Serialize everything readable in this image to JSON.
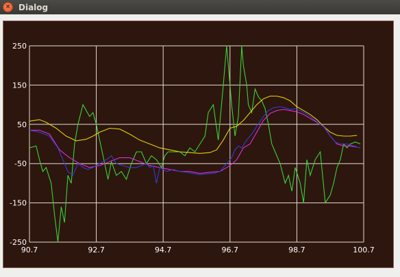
{
  "window": {
    "title": "Dialog",
    "close_glyph": "×"
  },
  "colors": {
    "plot_background": "#2d160e",
    "grid": "#e6dccf",
    "green": "#39d339",
    "yellow": "#e6d200",
    "magenta": "#e02bd8",
    "blue": "#2f3fd0"
  },
  "chart_data": {
    "type": "line",
    "grid": true,
    "xlim": [
      90.7,
      100.7
    ],
    "ylim": [
      -250,
      250
    ],
    "x_ticks": [
      "90.7",
      "92.7",
      "94.7",
      "96.7",
      "98.7",
      "100.7"
    ],
    "y_ticks": [
      "250",
      "150",
      "50",
      "-50",
      "-150",
      "-250"
    ],
    "series": [
      {
        "color": "green",
        "x": [
          90.7,
          90.9,
          91.0,
          91.1,
          91.2,
          91.35,
          91.45,
          91.55,
          91.65,
          91.75,
          91.85,
          91.95,
          92.05,
          92.15,
          92.3,
          92.5,
          92.6,
          92.7,
          92.8,
          92.9,
          93.05,
          93.15,
          93.3,
          93.45,
          93.6,
          93.75,
          93.9,
          94.05,
          94.2,
          94.35,
          94.5,
          94.65,
          94.75,
          94.85,
          95.0,
          95.2,
          95.35,
          95.5,
          95.65,
          95.8,
          95.95,
          96.05,
          96.2,
          96.35,
          96.5,
          96.6,
          96.65,
          96.75,
          96.85,
          96.95,
          97.05,
          97.1,
          97.2,
          97.25,
          97.35,
          97.45,
          97.55,
          97.65,
          97.75,
          97.85,
          97.95,
          98.05,
          98.2,
          98.35,
          98.45,
          98.55,
          98.65,
          98.8,
          98.9,
          99.0,
          99.1,
          99.25,
          99.4,
          99.55,
          99.7,
          99.8,
          99.9,
          100.0,
          100.1,
          100.2,
          100.3,
          100.45,
          100.6
        ],
        "y": [
          -10,
          -5,
          -40,
          -70,
          -60,
          -100,
          -180,
          -250,
          -160,
          -200,
          -80,
          -100,
          0,
          50,
          100,
          70,
          80,
          50,
          10,
          -30,
          -90,
          -45,
          -80,
          -70,
          -90,
          -50,
          -20,
          -20,
          -50,
          -30,
          -40,
          -60,
          -30,
          -20,
          -20,
          -20,
          -30,
          -10,
          -20,
          0,
          20,
          80,
          100,
          10,
          150,
          250,
          200,
          100,
          20,
          70,
          250,
          200,
          150,
          100,
          80,
          140,
          120,
          110,
          90,
          50,
          0,
          -20,
          -50,
          -100,
          -80,
          -120,
          -60,
          -100,
          -150,
          -40,
          -80,
          -40,
          -20,
          -150,
          -130,
          -100,
          -60,
          -40,
          0,
          -10,
          0,
          5,
          0
        ]
      },
      {
        "color": "yellow",
        "x": [
          90.7,
          91.0,
          91.2,
          91.5,
          91.8,
          92.1,
          92.4,
          92.6,
          92.8,
          93.1,
          93.4,
          93.7,
          94.0,
          94.3,
          94.6,
          94.9,
          95.2,
          95.5,
          95.8,
          96.1,
          96.3,
          96.5,
          96.7,
          96.9,
          97.1,
          97.3,
          97.5,
          97.7,
          97.9,
          98.1,
          98.3,
          98.5,
          98.7,
          98.9,
          99.1,
          99.3,
          99.5,
          99.7,
          99.9,
          100.1,
          100.3,
          100.5
        ],
        "y": [
          58,
          62,
          55,
          40,
          20,
          8,
          12,
          20,
          30,
          40,
          38,
          25,
          10,
          0,
          -10,
          -15,
          -20,
          -22,
          -24,
          -22,
          -15,
          10,
          40,
          45,
          60,
          80,
          100,
          115,
          122,
          122,
          118,
          110,
          95,
          85,
          75,
          62,
          45,
          30,
          22,
          20,
          20,
          22
        ]
      },
      {
        "color": "magenta",
        "x": [
          90.7,
          91.0,
          91.3,
          91.6,
          91.9,
          92.2,
          92.5,
          92.8,
          93.1,
          93.4,
          93.7,
          94.0,
          94.3,
          94.6,
          94.9,
          95.2,
          95.5,
          95.8,
          96.1,
          96.4,
          96.7,
          96.9,
          97.1,
          97.3,
          97.5,
          97.7,
          97.9,
          98.1,
          98.3,
          98.5,
          98.7,
          98.9,
          99.1,
          99.3,
          99.5,
          99.7,
          99.9,
          100.1,
          100.3,
          100.5
        ],
        "y": [
          35,
          35,
          25,
          -15,
          -35,
          -50,
          -60,
          -55,
          -45,
          -35,
          -35,
          -45,
          -55,
          -60,
          -65,
          -70,
          -70,
          -75,
          -72,
          -70,
          -55,
          -40,
          -10,
          0,
          30,
          60,
          78,
          85,
          88,
          85,
          82,
          75,
          65,
          55,
          45,
          20,
          0,
          -5,
          -5,
          -8
        ]
      },
      {
        "color": "blue",
        "x": [
          90.7,
          91.0,
          91.3,
          91.55,
          91.7,
          91.85,
          92.0,
          92.15,
          92.3,
          92.45,
          92.6,
          92.8,
          93.0,
          93.15,
          93.3,
          93.5,
          93.7,
          93.9,
          94.05,
          94.2,
          94.3,
          94.4,
          94.5,
          94.6,
          94.8,
          95.0,
          95.2,
          95.4,
          95.6,
          95.8,
          96.0,
          96.2,
          96.4,
          96.5,
          96.6,
          96.75,
          96.85,
          96.95,
          97.05,
          97.2,
          97.35,
          97.5,
          97.7,
          97.85,
          98.0,
          98.2,
          98.35,
          98.5,
          98.65,
          98.8,
          98.95,
          99.1,
          99.25,
          99.4,
          99.55,
          99.7,
          99.85,
          100.0,
          100.2,
          100.4,
          100.6
        ],
        "y": [
          35,
          30,
          20,
          -10,
          -40,
          -70,
          -80,
          -50,
          -60,
          -65,
          -60,
          -50,
          -40,
          -30,
          -50,
          -55,
          -60,
          -60,
          -55,
          -50,
          -60,
          -55,
          -100,
          -60,
          -70,
          -65,
          -70,
          -72,
          -75,
          -78,
          -76,
          -75,
          -70,
          -60,
          -50,
          -35,
          -15,
          -5,
          -10,
          10,
          25,
          45,
          70,
          85,
          92,
          95,
          92,
          88,
          90,
          85,
          78,
          70,
          60,
          50,
          40,
          20,
          5,
          0,
          0,
          -5,
          -10
        ]
      }
    ]
  }
}
